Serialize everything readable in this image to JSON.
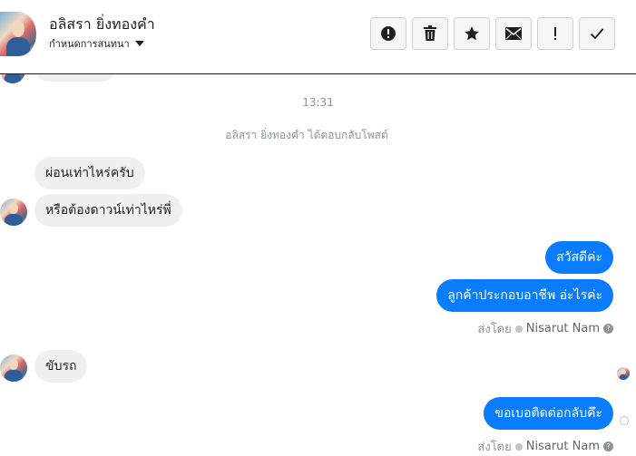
{
  "header": {
    "name": "อลิสรา ยิ่งทองคำ",
    "subtitle": "กำหนดการสนทนา",
    "actions": [
      {
        "name": "report-button",
        "icon": "alert-circle-icon"
      },
      {
        "name": "delete-button",
        "icon": "trash-icon"
      },
      {
        "name": "star-button",
        "icon": "star-icon"
      },
      {
        "name": "mark-unread-button",
        "icon": "envelope-icon"
      },
      {
        "name": "important-button",
        "icon": "exclamation-icon"
      },
      {
        "name": "done-button",
        "icon": "checkmark-icon"
      }
    ]
  },
  "conversation": {
    "timestamp": "13:31",
    "system_note": "อลิสรา ยิ่งทองคำ ได้ตอบกลับโพสต์",
    "messages": [
      {
        "from": "contact",
        "text": "ผ่อนเท่าไหร่ครับ"
      },
      {
        "from": "contact",
        "text": "หรือต้องดาวน์เท่าไหร่พี่"
      },
      {
        "from": "page",
        "text": "สวัสดีค่ะ"
      },
      {
        "from": "page",
        "text": "ลูกค้าประกอบอาชีพ อ่ะไรค่ะ"
      },
      {
        "from": "contact",
        "text": "ขับรถ"
      },
      {
        "from": "page",
        "text": "ขอเบอติดต่อกลับคึะ"
      }
    ],
    "sent_by_label": "ส่งโดย",
    "sent_by_name": "Nisarut Nam",
    "help_glyph": "?"
  },
  "colors": {
    "outgoing_bubble": "#0a7cff",
    "incoming_bubble": "#f1f0f0",
    "muted_text": "#8d949e"
  }
}
